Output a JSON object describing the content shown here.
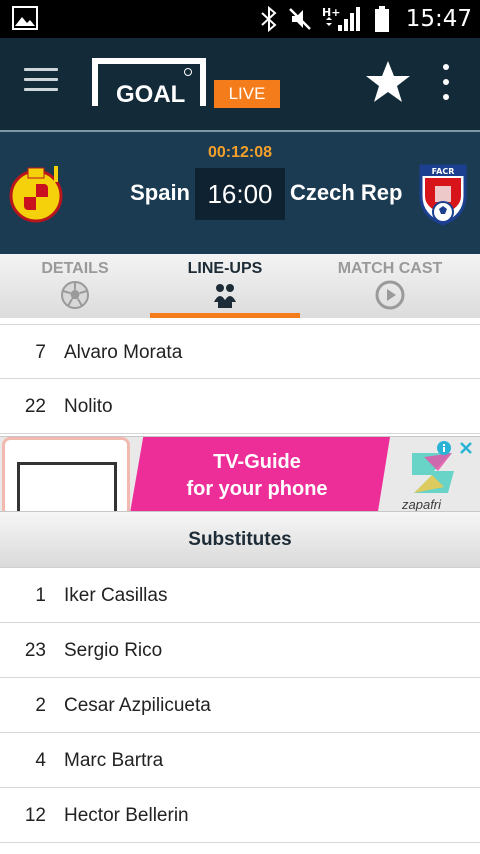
{
  "status_bar": {
    "time": "15:47",
    "icons": [
      "gallery-icon",
      "bluetooth-icon",
      "mute-icon",
      "hspa-signal-icon",
      "battery-icon"
    ]
  },
  "app_bar": {
    "logo_text": "GOAL",
    "live_badge": "LIVE",
    "icons": [
      "menu-icon",
      "star-icon",
      "more-vert-icon"
    ]
  },
  "match": {
    "elapsed": "00:12:08",
    "home_team": "Spain",
    "away_team": "Czech Rep",
    "kickoff": "16:00"
  },
  "tabs": [
    {
      "label": "DETAILS",
      "icon": "football-icon",
      "active": false
    },
    {
      "label": "LINE-UPS",
      "icon": "players-icon",
      "active": true
    },
    {
      "label": "MATCH CAST",
      "icon": "play-circle-icon",
      "active": false
    }
  ],
  "lineup_tail": [
    {
      "number": "7",
      "name": "Alvaro Morata"
    },
    {
      "number": "22",
      "name": "Nolito"
    }
  ],
  "ad": {
    "headline_line1": "TV-Guide",
    "headline_line2": "for your phone",
    "brand": "zapafri"
  },
  "substitutes": {
    "title": "Substitutes",
    "players": [
      {
        "number": "1",
        "name": "Iker Casillas"
      },
      {
        "number": "23",
        "name": "Sergio Rico"
      },
      {
        "number": "2",
        "name": "Cesar Azpilicueta"
      },
      {
        "number": "4",
        "name": "Marc Bartra"
      },
      {
        "number": "12",
        "name": "Hector Bellerin"
      }
    ]
  },
  "colors": {
    "app_bar": "#132a38",
    "match_header": "#1b3b52",
    "accent": "#f47c1a",
    "timer": "#f4a02a",
    "ad_pink": "#ee2e98"
  }
}
